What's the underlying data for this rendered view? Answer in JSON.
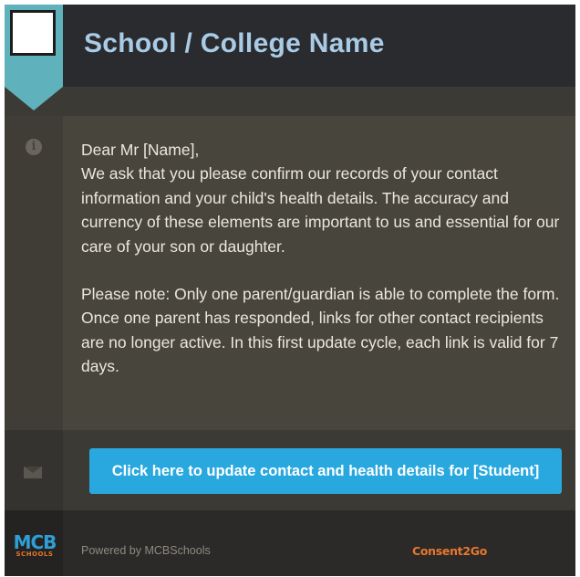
{
  "header": {
    "title": "School / College Name"
  },
  "message": {
    "greeting": "Dear  Mr [Name],",
    "paragraph1": "We ask that you please confirm our records of your contact information and your child's health details. The accuracy and currency of these elements are important to us and essential for our care of your son or daughter.",
    "paragraph2": "Please note: Only one parent/guardian is able to complete the form. Once one parent has responded, links for other contact recipients are no longer active. In this first update cycle, each link is valid for 7 days."
  },
  "action": {
    "button_label": "Click here to update contact and health details for [Student]"
  },
  "footer": {
    "powered_by": "Powered by MCBSchools",
    "mcb_logo_text": "MCB",
    "mcb_logo_sub": "SCHOOLS",
    "consent_logo_text": "Consent2Go"
  },
  "icons": {
    "info": "info-icon",
    "mail": "mail-icon"
  },
  "colors": {
    "header_bg": "#2a2b2f",
    "accent_teal": "#5fb1bb",
    "title_text": "#a9cbe6",
    "button_bg": "#29a8df",
    "consent_orange": "#e8772e"
  }
}
